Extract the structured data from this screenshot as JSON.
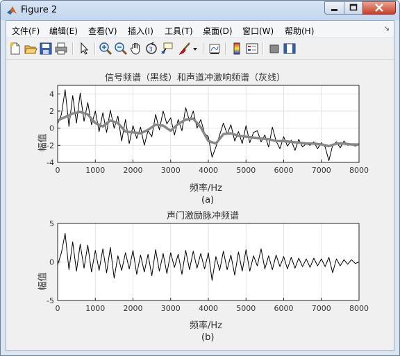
{
  "window": {
    "title": "Figure 2",
    "colors": {
      "close": "#c7402a",
      "titlebar": "#c2d6ee"
    }
  },
  "menu": {
    "items": [
      "文件(F)",
      "编辑(E)",
      "查看(V)",
      "插入(I)",
      "工具(T)",
      "桌面(D)",
      "窗口(W)",
      "帮助(H)"
    ]
  },
  "toolbar": {
    "icons": [
      "new-figure-icon",
      "open-file-icon",
      "save-icon",
      "print-icon",
      "pointer-icon",
      "zoom-in-icon",
      "zoom-out-icon",
      "pan-hand-icon",
      "rotate-3d-icon",
      "data-cursor-icon",
      "brush-icon",
      "brush-dropdown-icon",
      "link-plot-icon",
      "colorbar-icon",
      "legend-icon",
      "hide-plot-tools-icon",
      "show-plot-tools-icon"
    ]
  },
  "plots": {
    "a": {
      "caption": "(a)"
    },
    "b": {
      "caption": "(b)"
    }
  },
  "chart_data": [
    {
      "type": "line",
      "title": "信号频谱（黑线）和声道冲激响频谱（灰线）",
      "xlabel": "频率/Hz",
      "ylabel": "幅值",
      "xlim": [
        0,
        8000
      ],
      "ylim": [
        -4,
        5
      ],
      "xticks": [
        0,
        1000,
        2000,
        3000,
        4000,
        5000,
        6000,
        7000,
        8000
      ],
      "yticks": [
        4,
        2,
        0,
        -2,
        -4
      ],
      "grid": true,
      "series": [
        {
          "color": "#000000",
          "x": [
            0,
            100,
            200,
            300,
            400,
            500,
            600,
            700,
            800,
            900,
            1000,
            1100,
            1200,
            1300,
            1400,
            1500,
            1600,
            1700,
            1800,
            1900,
            2000,
            2100,
            2200,
            2300,
            2400,
            2500,
            2600,
            2700,
            2800,
            2900,
            3000,
            3100,
            3200,
            3300,
            3400,
            3500,
            3600,
            3700,
            3800,
            3900,
            4000,
            4100,
            4200,
            4300,
            4400,
            4500,
            4600,
            4700,
            4800,
            4900,
            5000,
            5100,
            5200,
            5300,
            5400,
            5500,
            5600,
            5700,
            5800,
            5900,
            6000,
            6100,
            6200,
            6300,
            6400,
            6500,
            6600,
            6700,
            6800,
            6900,
            7000,
            7100,
            7200,
            7300,
            7400,
            7500,
            7600,
            7700,
            7800,
            7900,
            8000
          ],
          "y": [
            0.5,
            1.6,
            4.5,
            0.2,
            3.8,
            0.6,
            4.1,
            0.8,
            3.0,
            0.4,
            2.0,
            -0.4,
            1.8,
            -0.5,
            2.1,
            0.0,
            1.4,
            -1.5,
            1.0,
            -1.8,
            0.3,
            -1.2,
            0.1,
            -2.0,
            -0.3,
            -1.0,
            1.6,
            -0.2,
            2.0,
            0.5,
            1.2,
            -0.8,
            1.0,
            -0.3,
            2.4,
            0.8,
            2.0,
            0.0,
            1.0,
            -0.6,
            -1.0,
            -3.4,
            -2.2,
            -0.8,
            0.6,
            -0.7,
            0.4,
            -1.5,
            -0.4,
            -1.8,
            0.3,
            -1.7,
            -0.5,
            -0.3,
            -1.6,
            -0.8,
            -2.2,
            0.1,
            -1.5,
            -2.4,
            -1.0,
            -2.1,
            -1.4,
            -2.6,
            -1.3,
            -2.2,
            -1.8,
            -2.0,
            -1.6,
            -2.4,
            -1.7,
            -2.2,
            -3.8,
            -2.0,
            -1.6,
            -2.3,
            -1.5,
            -2.0,
            -1.9,
            -2.1,
            -1.9
          ]
        },
        {
          "color": "#888888",
          "x": [
            0,
            200,
            400,
            600,
            800,
            1000,
            1200,
            1400,
            1600,
            1800,
            2000,
            2200,
            2400,
            2600,
            2800,
            3000,
            3200,
            3400,
            3600,
            3800,
            4000,
            4200,
            4400,
            4600,
            4800,
            5000,
            5200,
            5400,
            5600,
            5800,
            6000,
            6200,
            6400,
            6600,
            6800,
            7000,
            7200,
            7400,
            7600,
            7800,
            8000
          ],
          "y": [
            0.9,
            1.3,
            1.7,
            1.9,
            1.6,
            0.6,
            0.2,
            0.9,
            0.6,
            -0.4,
            -0.5,
            -0.6,
            -0.2,
            0.4,
            0.3,
            -0.3,
            0.5,
            1.0,
            1.1,
            0.1,
            -1.5,
            -1.8,
            -0.7,
            -0.6,
            -0.9,
            -1.0,
            -1.1,
            -1.2,
            -1.3,
            -1.5,
            -1.5,
            -1.6,
            -1.7,
            -1.8,
            -1.8,
            -1.9,
            -2.1,
            -1.8,
            -1.8,
            -1.9,
            -1.9
          ]
        }
      ]
    },
    {
      "type": "line",
      "title": "声门激励脉冲频谱",
      "xlabel": "频率/Hz",
      "ylabel": "幅值",
      "xlim": [
        0,
        8000
      ],
      "ylim": [
        -5,
        5
      ],
      "xticks": [
        0,
        1000,
        2000,
        3000,
        4000,
        5000,
        6000,
        7000,
        8000
      ],
      "yticks": [
        5,
        0,
        -5
      ],
      "grid": true,
      "series": [
        {
          "color": "#000000",
          "x": [
            0,
            100,
            200,
            300,
            400,
            500,
            600,
            700,
            800,
            900,
            1000,
            1100,
            1200,
            1300,
            1400,
            1500,
            1600,
            1700,
            1800,
            1900,
            2000,
            2100,
            2200,
            2300,
            2400,
            2500,
            2600,
            2700,
            2800,
            2900,
            3000,
            3100,
            3200,
            3300,
            3400,
            3500,
            3600,
            3700,
            3800,
            3900,
            4000,
            4100,
            4200,
            4300,
            4400,
            4500,
            4600,
            4700,
            4800,
            4900,
            5000,
            5100,
            5200,
            5300,
            5400,
            5500,
            5600,
            5700,
            5800,
            5900,
            6000,
            6100,
            6200,
            6300,
            6400,
            6500,
            6600,
            6700,
            6800,
            6900,
            7000,
            7100,
            7200,
            7300,
            7400,
            7500,
            7600,
            7700,
            7800,
            7900,
            8000
          ],
          "y": [
            -0.4,
            1.2,
            3.7,
            -1.0,
            2.6,
            -1.2,
            2.3,
            -0.8,
            2.2,
            -1.3,
            1.5,
            -1.1,
            1.7,
            -1.4,
            1.9,
            -2.1,
            0.8,
            -1.1,
            1.2,
            -0.9,
            1.5,
            -1.6,
            0.9,
            -1.3,
            1.0,
            -1.8,
            1.6,
            -1.2,
            1.1,
            -1.5,
            1.2,
            -0.7,
            1.0,
            -1.6,
            1.5,
            -1.0,
            1.4,
            -0.8,
            1.1,
            -0.9,
            1.2,
            -2.4,
            0.7,
            -1.1,
            1.4,
            -1.0,
            0.9,
            -1.7,
            1.3,
            -1.2,
            1.6,
            -1.2,
            0.8,
            -0.5,
            1.7,
            -0.9,
            0.8,
            -1.0,
            0.9,
            -0.6,
            0.7,
            -0.9,
            0.6,
            -0.8,
            0.5,
            -0.6,
            0.4,
            -0.7,
            0.5,
            -0.5,
            0.4,
            -0.6,
            0.6,
            -1.4,
            0.4,
            -0.5,
            0.3,
            -0.3,
            0.3,
            -0.2,
            0.0
          ]
        }
      ]
    }
  ]
}
